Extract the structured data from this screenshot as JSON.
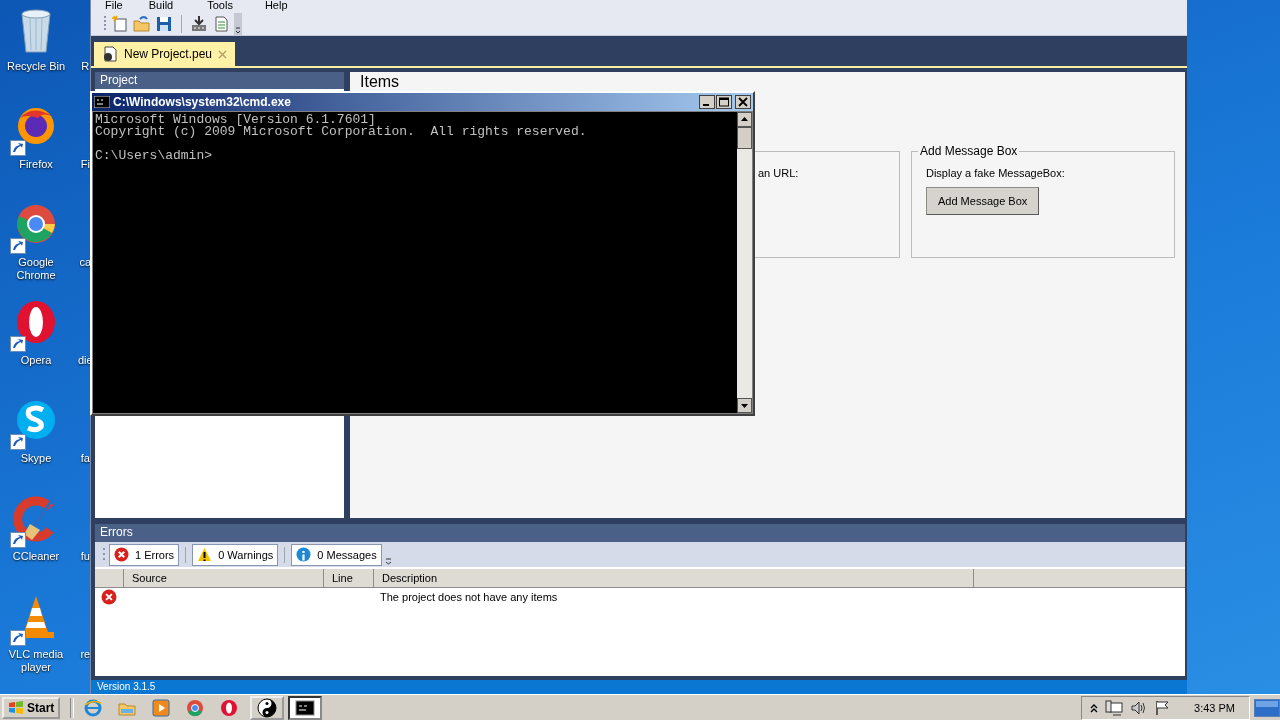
{
  "desktop_icons": [
    {
      "label": "Recycle Bin",
      "kind": "recycle",
      "shortcut": false
    },
    {
      "label": "Firefox",
      "kind": "firefox",
      "shortcut": true
    },
    {
      "label": "Google Chrome",
      "kind": "chrome",
      "shortcut": true
    },
    {
      "label": "Opera",
      "kind": "opera",
      "shortcut": true
    },
    {
      "label": "Skype",
      "kind": "skype",
      "shortcut": true
    },
    {
      "label": "CCleaner",
      "kind": "ccleaner",
      "shortcut": true
    },
    {
      "label": "VLC media player",
      "kind": "vlc",
      "shortcut": true
    }
  ],
  "desktop_labels_cut": [
    "R",
    "Fi",
    "ca",
    "die",
    "fa",
    "fu",
    "re"
  ],
  "app": {
    "menu": [
      "File",
      "Build",
      "Tools",
      "Help"
    ],
    "toolbar": [
      {
        "kind": "new"
      },
      {
        "kind": "open"
      },
      {
        "kind": "save"
      },
      {
        "kind": "separator"
      },
      {
        "kind": "build"
      },
      {
        "kind": "document"
      }
    ],
    "document_tabs": [
      {
        "label": "New Project.peu",
        "selected": true
      }
    ],
    "project_panel": {
      "title": "Project"
    },
    "items_panel": {
      "title": "Items",
      "groups": [
        {
          "text": "an URL:"
        },
        {
          "legend": "Add Message Box",
          "text": "Display a fake MessageBox:",
          "button": "Add Message Box"
        }
      ]
    },
    "errors_panel": {
      "title": "Errors",
      "filters": [
        {
          "kind": "error",
          "label": "1 Errors"
        },
        {
          "kind": "warning",
          "label": "0 Warnings"
        },
        {
          "kind": "info",
          "label": "0 Messages"
        }
      ],
      "columns": [
        "Source",
        "Line",
        "Description"
      ],
      "rows": [
        {
          "kind": "error",
          "description": "The project does not have any items"
        }
      ]
    },
    "status_bar": "Version 3.1.5"
  },
  "console_window": {
    "title": "C:\\Windows\\system32\\cmd.exe",
    "output": [
      "Microsoft Windows [Version 6.1.7601]",
      "Copyright (c) 2009 Microsoft Corporation.  All rights reserved."
    ],
    "prompt": "C:\\Users\\admin>"
  },
  "taskbar": {
    "start": "Start",
    "pinned": [
      {
        "kind": "ie"
      },
      {
        "kind": "explorer"
      },
      {
        "kind": "media"
      },
      {
        "kind": "chrome"
      },
      {
        "kind": "opera"
      }
    ],
    "tasks": [
      {
        "kind": "yinyang",
        "selected": false
      },
      {
        "kind": "cmd",
        "selected": true
      }
    ],
    "clock": "3:43 PM"
  }
}
